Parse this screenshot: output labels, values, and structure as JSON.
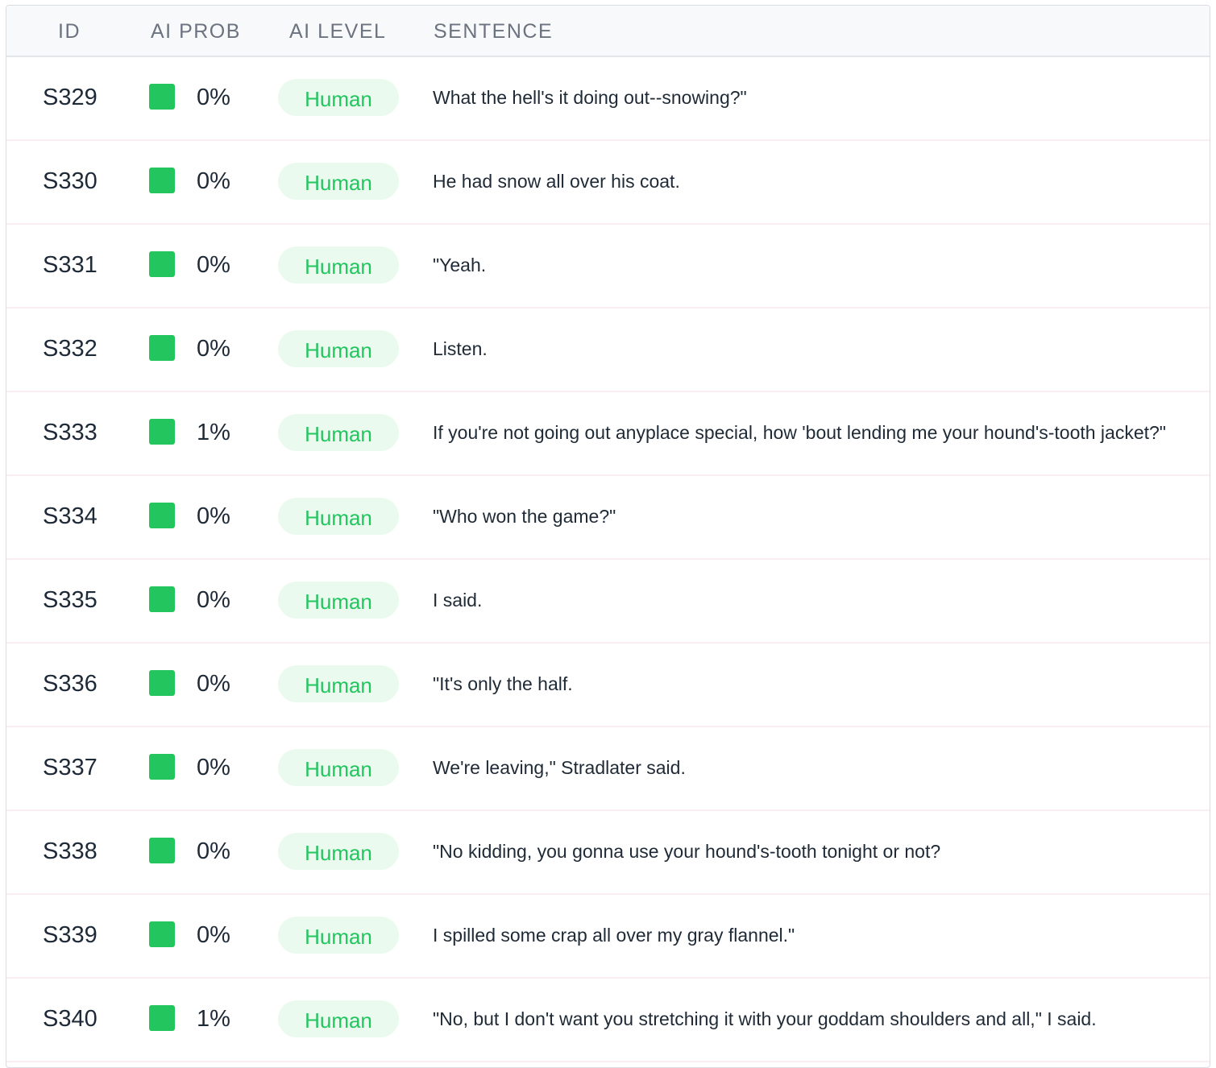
{
  "columns": {
    "id": "ID",
    "ai_prob": "AI PROB",
    "ai_level": "AI LEVEL",
    "sentence": "SENTENCE"
  },
  "colors": {
    "human_swatch": "#22c55e",
    "human_badge_bg": "#eafaef",
    "human_badge_text": "#22c55e"
  },
  "rows": [
    {
      "id": "S329",
      "prob": "0%",
      "level": "Human",
      "sentence": "What the hell's it doing out--snowing?\""
    },
    {
      "id": "S330",
      "prob": "0%",
      "level": "Human",
      "sentence": "He had snow all over his coat."
    },
    {
      "id": "S331",
      "prob": "0%",
      "level": "Human",
      "sentence": "\"Yeah."
    },
    {
      "id": "S332",
      "prob": "0%",
      "level": "Human",
      "sentence": "Listen."
    },
    {
      "id": "S333",
      "prob": "1%",
      "level": "Human",
      "sentence": "If you're not going out anyplace special, how 'bout lending me your hound's-tooth jacket?\""
    },
    {
      "id": "S334",
      "prob": "0%",
      "level": "Human",
      "sentence": "\"Who won the game?\""
    },
    {
      "id": "S335",
      "prob": "0%",
      "level": "Human",
      "sentence": "I said."
    },
    {
      "id": "S336",
      "prob": "0%",
      "level": "Human",
      "sentence": "\"It's only the half."
    },
    {
      "id": "S337",
      "prob": "0%",
      "level": "Human",
      "sentence": "We're leaving,\" Stradlater said."
    },
    {
      "id": "S338",
      "prob": "0%",
      "level": "Human",
      "sentence": "\"No kidding, you gonna use your hound's-tooth tonight or not?"
    },
    {
      "id": "S339",
      "prob": "0%",
      "level": "Human",
      "sentence": "I spilled some crap all over my gray flannel.\""
    },
    {
      "id": "S340",
      "prob": "1%",
      "level": "Human",
      "sentence": "\"No, but I don't want you stretching it with your goddam shoulders and all,\" I said."
    }
  ]
}
